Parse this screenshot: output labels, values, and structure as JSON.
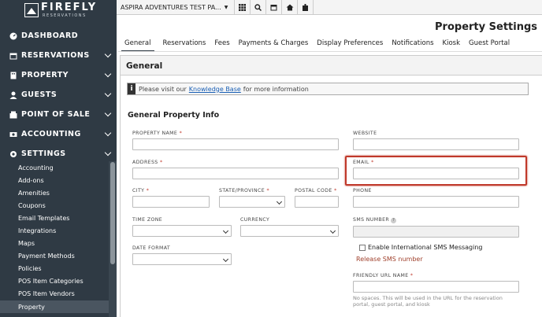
{
  "brand": {
    "name": "FIREFLY",
    "sub": "RESERVATIONS"
  },
  "topbar": {
    "property": "ASPIRA ADVENTURES TEST PA...",
    "icons": [
      "grid-icon",
      "search-icon",
      "calendar-icon",
      "home-icon",
      "building-icon"
    ]
  },
  "sidebar": {
    "items": [
      {
        "label": "DASHBOARD",
        "icon": "dashboard-icon"
      },
      {
        "label": "RESERVATIONS",
        "icon": "calendar-icon"
      },
      {
        "label": "PROPERTY",
        "icon": "property-icon"
      },
      {
        "label": "GUESTS",
        "icon": "user-icon"
      },
      {
        "label": "POINT OF SALE",
        "icon": "pos-icon"
      },
      {
        "label": "ACCOUNTING",
        "icon": "accounting-icon"
      },
      {
        "label": "SETTINGS",
        "icon": "gear-icon"
      }
    ],
    "settings_sub": [
      "Accounting",
      "Add-ons",
      "Amenities",
      "Coupons",
      "Email Templates",
      "Integrations",
      "Maps",
      "Payment Methods",
      "Policies",
      "POS Item Categories",
      "POS Item Vendors",
      "Property"
    ]
  },
  "page": {
    "title": "Property Settings"
  },
  "tabs": [
    "General",
    "Reservations",
    "Fees",
    "Payments & Charges",
    "Display Preferences",
    "Notifications",
    "Kiosk",
    "Guest Portal"
  ],
  "panel": {
    "title": "General",
    "info_pre": "Please visit our",
    "info_link": "Knowledge Base",
    "info_post": "for more information",
    "section": "General Property Info"
  },
  "fields": {
    "property_name": "PROPERTY NAME",
    "website": "WEBSITE",
    "address": "ADDRESS",
    "email": "EMAIL",
    "city": "CITY",
    "state": "STATE/PROVINCE",
    "postal": "POSTAL CODE",
    "phone": "PHONE",
    "timezone": "TIME ZONE",
    "currency": "CURRENCY",
    "sms": "SMS NUMBER",
    "date_format": "DATE FORMAT",
    "intl_sms": "Enable International SMS Messaging",
    "release_sms": "Release SMS number",
    "friendly_url": "FRIENDLY URL NAME",
    "friendly_help": "No spaces. This will be used in the URL for the reservation portal, guest portal, and kiosk"
  },
  "colors": {
    "sidebar": "#2f3a44",
    "required": "#c0392b",
    "highlight": "#c0392b"
  }
}
